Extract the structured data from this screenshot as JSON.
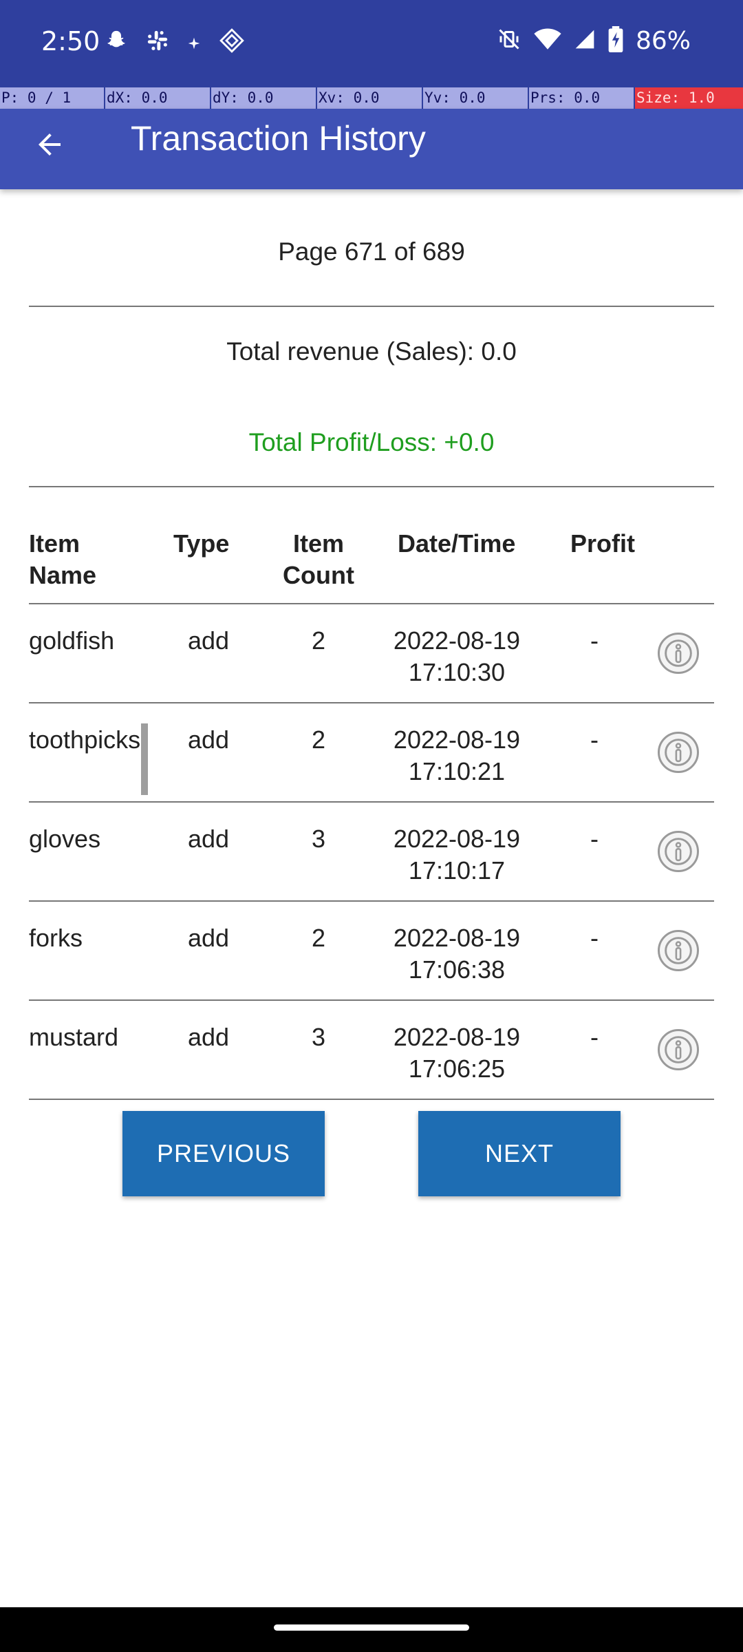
{
  "status_bar": {
    "time": "2:50",
    "notification_icons": [
      "snapchat-icon",
      "slack-icon",
      "sparkle-icon",
      "diamond-icon"
    ],
    "battery_percent": "86%"
  },
  "pointer_overlay": {
    "p": "P: 0 / 1",
    "dx": "dX: 0.0",
    "dy": "dY: 0.0",
    "xv": "Xv: 0.0",
    "yv": "Yv: 0.0",
    "prs": "Prs: 0.0",
    "size": "Size: 1.0"
  },
  "app_bar": {
    "title": "Transaction History"
  },
  "summary": {
    "page": "Page 671 of 689",
    "revenue": "Total revenue (Sales): 0.0",
    "profit_loss": "Total Profit/Loss: +0.0"
  },
  "table": {
    "headers": {
      "name_line1": "Item",
      "name_line2": "Name",
      "type": "Type",
      "count_line1": "Item",
      "count_line2": "Count",
      "datetime": "Date/Time",
      "profit": "Profit"
    },
    "rows": [
      {
        "name": "goldfish",
        "type": "add",
        "count": "2",
        "date": "2022-08-19",
        "time": "17:10:30",
        "profit": "-"
      },
      {
        "name": "toothpicks",
        "type": "add",
        "count": "2",
        "date": "2022-08-19",
        "time": "17:10:21",
        "profit": "-"
      },
      {
        "name": "gloves",
        "type": "add",
        "count": "3",
        "date": "2022-08-19",
        "time": "17:10:17",
        "profit": "-"
      },
      {
        "name": "forks",
        "type": "add",
        "count": "2",
        "date": "2022-08-19",
        "time": "17:06:38",
        "profit": "-"
      },
      {
        "name": "mustard",
        "type": "add",
        "count": "3",
        "date": "2022-08-19",
        "time": "17:06:25",
        "profit": "-"
      }
    ]
  },
  "buttons": {
    "previous": "PREVIOUS",
    "next": "NEXT"
  },
  "colors": {
    "status_bar": "#2f3f9e",
    "app_bar": "#3f51b5",
    "profit_positive": "#1f9e1f",
    "button": "#1e6db3"
  }
}
